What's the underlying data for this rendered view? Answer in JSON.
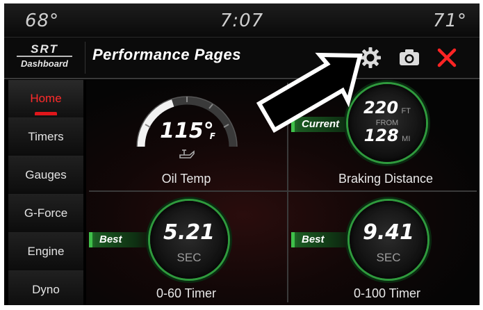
{
  "status_bar": {
    "temp_left": "68°",
    "clock": "7:07",
    "temp_right": "71°"
  },
  "header": {
    "logo_line1": "SRT",
    "logo_line2": "Dashboard",
    "title": "Performance Pages",
    "icons": [
      "gear-icon",
      "camera-icon",
      "close-icon"
    ]
  },
  "sidebar": {
    "items": [
      {
        "label": "Home",
        "active": true
      },
      {
        "label": "Timers"
      },
      {
        "label": "Gauges"
      },
      {
        "label": "G-Force"
      },
      {
        "label": "Engine"
      },
      {
        "label": "Dyno"
      }
    ]
  },
  "tiles": {
    "oil_temp": {
      "value": "115°",
      "unit": "F",
      "label": "Oil Temp",
      "gauge_level": 0.4
    },
    "braking": {
      "tag": "Current",
      "distance": "220",
      "distance_unit": "FT",
      "from_word": "FROM",
      "speed": "128",
      "speed_unit": "MI",
      "label": "Braking Distance"
    },
    "timer_060": {
      "tag": "Best",
      "value": "5.21",
      "unit": "SEC",
      "label": "0-60 Timer"
    },
    "timer_0100": {
      "tag": "Best",
      "value": "9.41",
      "unit": "SEC",
      "label": "0-100 Timer"
    }
  },
  "colors": {
    "accent_red": "#e0161b",
    "accent_green": "#2f9a3d"
  }
}
